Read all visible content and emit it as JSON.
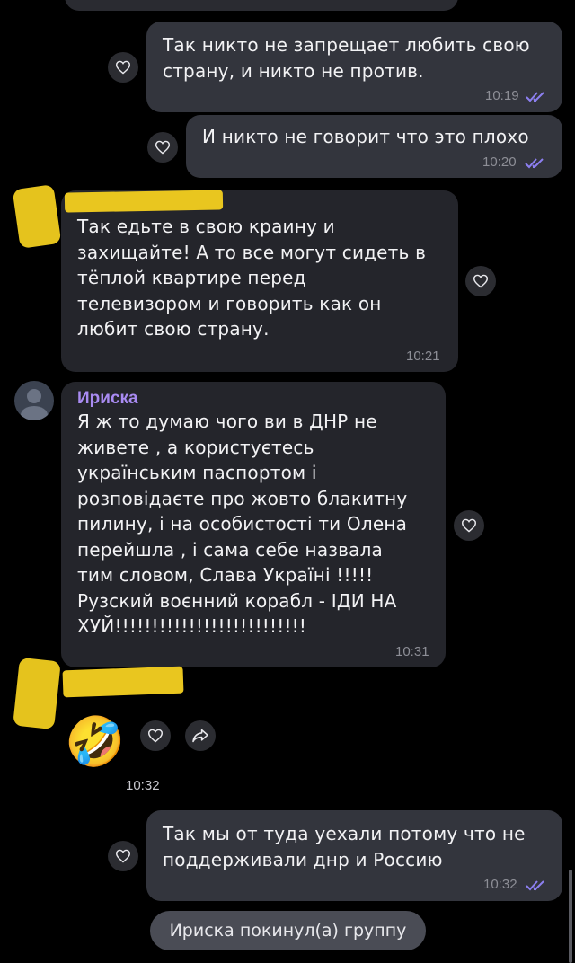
{
  "messages": [
    {
      "text": "Так никто не запрещает любить свою\nстрану, и никто не против.",
      "time": "10:19"
    },
    {
      "text": "И никто не говорит что это плохо",
      "time": "10:20"
    },
    {
      "text": "Так едьте в свою краину и\nзахищайте! А то все могут сидеть в\nтёплой квартире перед\nтелевизором и говорить как он\nлюбит свою страну.",
      "time": "10:21"
    },
    {
      "sender": "Ириска",
      "text": "Я ж то думаю чого ви в ДНР не\nживете , а користуєтесь\nукраїнським паспортом і\nрозповідаєте про жовто блакитну\nпилину, і на особистості ти Олена\nперейшла , і сама себе назвала\nтим словом, Слава Україні !!!!!\nРузский воєнний корабл - ІДИ НА\nХУЙ!!!!!!!!!!!!!!!!!!!!!!!!!!",
      "time": "10:31"
    },
    {
      "emoji": "🤣",
      "time": "10:32"
    },
    {
      "text": "Так мы от туда уехали потому что не\nподдерживали днр и Россию",
      "time": "10:32"
    }
  ],
  "service_message": "Ириска покинул(а) группу",
  "colors": {
    "outgoing_bubble": "#33353d",
    "incoming_bubble": "#24252b",
    "sender_name": "#a98bf2",
    "read_checks": "#8c7ff0",
    "redaction": "#e9c61f"
  },
  "icons": {
    "reaction": "heart-outline-icon",
    "forward": "share-arrow-icon",
    "read": "double-check-icon"
  }
}
